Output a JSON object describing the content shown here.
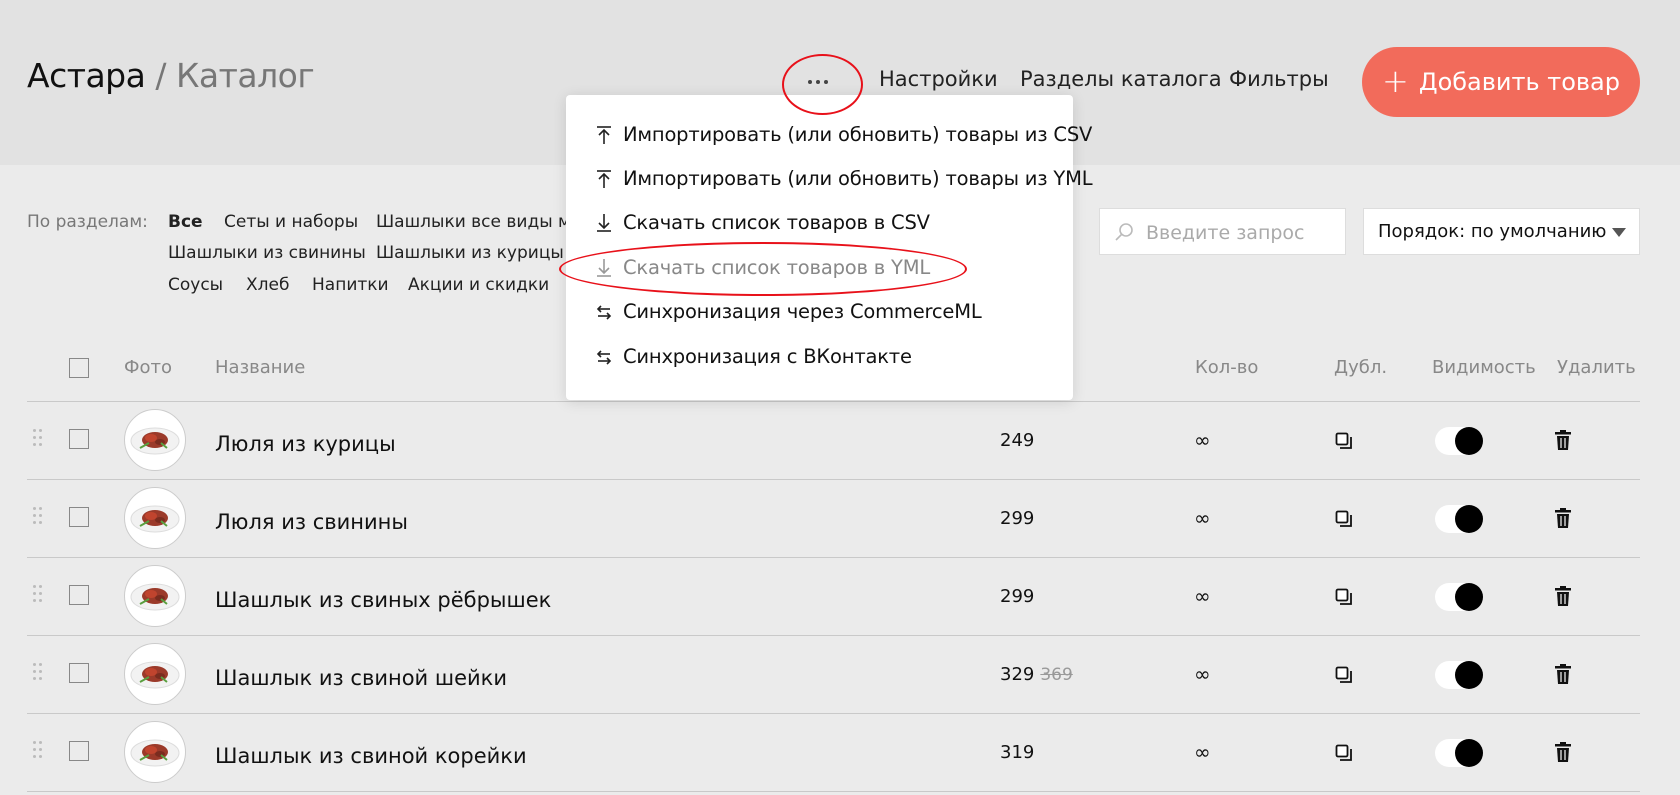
{
  "header": {
    "shop_name": "Астара",
    "separator": "/",
    "page_title": "Каталог",
    "links": [
      "Настройки",
      "Разделы каталога",
      "Фильтры"
    ],
    "add_button": "Добавить товар",
    "add_icon": "+",
    "accent_color": "#f26b5b"
  },
  "more_menu": {
    "items": [
      {
        "label": "Импортировать (или обновить) товары из CSV",
        "icon": "upload-icon"
      },
      {
        "label": "Импортировать (или обновить) товары из YML",
        "icon": "upload-icon"
      },
      {
        "label": "Скачать список товаров в CSV",
        "icon": "download-icon"
      },
      {
        "label": "Скачать список товаров в YML",
        "icon": "download-icon"
      },
      {
        "label": "Синхронизация через CommerceML",
        "icon": "sync-icon"
      },
      {
        "label": "Синхронизация с ВКонтакте",
        "icon": "sync-icon"
      }
    ]
  },
  "filters": {
    "label": "По разделам:",
    "categories": [
      "Все",
      "Сеты и наборы",
      "Шашлыки все виды мя",
      "Шашлыки из свинины",
      "Шашлыки из курицы",
      "Соусы",
      "Хлеб",
      "Напитки",
      "Акции и скидки"
    ],
    "active_category": "Все",
    "search_placeholder": "Введите запрос",
    "sort_label": "Порядок: по умолчанию"
  },
  "table": {
    "headers": {
      "photo": "Фото",
      "name": "Название",
      "qty": "Кол-во",
      "dup": "Дубл.",
      "visibility": "Видимость",
      "delete": "Удалить"
    },
    "rows": [
      {
        "name": "Люля из курицы",
        "price": "249",
        "old_price": "",
        "qty": "∞",
        "visible": true
      },
      {
        "name": "Люля из свинины",
        "price": "299",
        "old_price": "",
        "qty": "∞",
        "visible": true
      },
      {
        "name": "Шашлык из свиных рёбрышек",
        "price": "299",
        "old_price": "",
        "qty": "∞",
        "visible": true
      },
      {
        "name": "Шашлык из свиной шейки",
        "price": "329",
        "old_price": "369",
        "qty": "∞",
        "visible": true
      },
      {
        "name": "Шашлык из свиной корейки",
        "price": "319",
        "old_price": "",
        "qty": "∞",
        "visible": true
      }
    ]
  },
  "annotation_color": "#e8111a"
}
